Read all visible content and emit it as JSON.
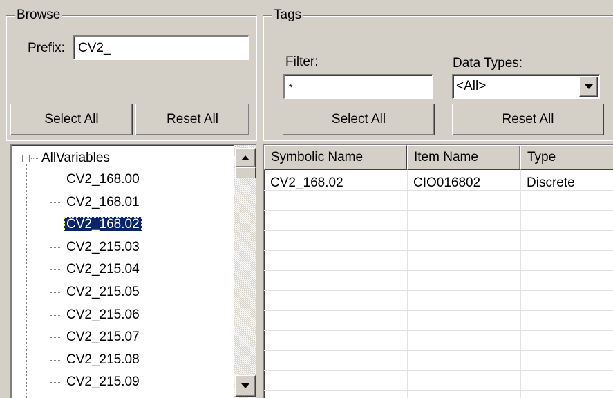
{
  "browse": {
    "title": "Browse",
    "prefix_label": "Prefix:",
    "prefix_value": "CV2_",
    "select_all": "Select All",
    "reset_all": "Reset All"
  },
  "tags": {
    "title": "Tags",
    "filter_label": "Filter:",
    "filter_value": "*",
    "data_types_label": "Data Types:",
    "data_types_value": "<All>",
    "select_all": "Select All",
    "reset_all": "Reset All"
  },
  "tree": {
    "root": "AllVariables",
    "root_expander": "−",
    "selected_index": 2,
    "items": [
      "CV2_168.00",
      "CV2_168.01",
      "CV2_168.02",
      "CV2_215.03",
      "CV2_215.04",
      "CV2_215.05",
      "CV2_215.06",
      "CV2_215.07",
      "CV2_215.08",
      "CV2_215.09"
    ]
  },
  "table": {
    "columns": [
      "Symbolic Name",
      "Item Name",
      "Type"
    ],
    "rows": [
      [
        "CV2_168.02",
        "CIO016802",
        "Discrete"
      ]
    ]
  },
  "icons": {
    "scroll_up": "triangle-up-icon",
    "scroll_down": "triangle-down-icon",
    "dropdown": "triangle-down-icon",
    "collapse": "minus-box-icon"
  }
}
